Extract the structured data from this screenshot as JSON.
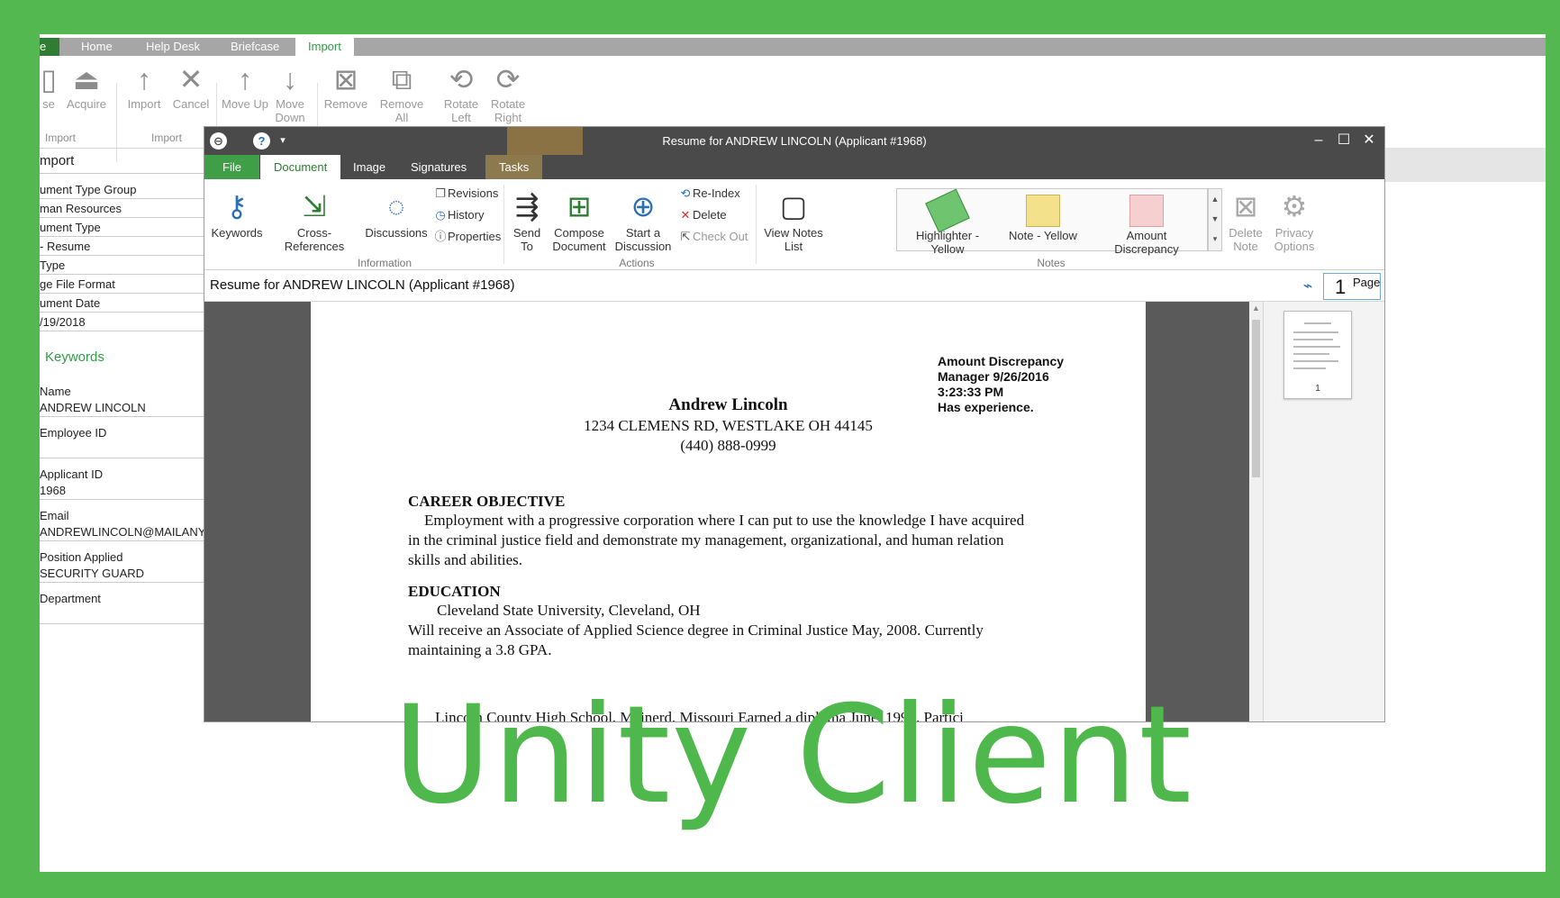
{
  "colors": {
    "frame_green": "#52b84f",
    "brand_green": "#4fb84c",
    "accent": "#2a6fb5"
  },
  "background_app": {
    "tabs": [
      "Home",
      "Help Desk",
      "Briefcase",
      "Import"
    ],
    "active_tab": "Import",
    "ribbon_buttons": [
      {
        "label": "se",
        "icon": "doc-icon"
      },
      {
        "label": "Acquire",
        "icon": "scanner-icon"
      },
      {
        "label": "Import",
        "icon": "arrow-up-icon"
      },
      {
        "label": "Cancel",
        "icon": "x-icon"
      },
      {
        "label": "Move Up",
        "icon": "arrow-up-icon"
      },
      {
        "label": "Move Down",
        "icon": "arrow-down-icon"
      },
      {
        "label": "Remove",
        "icon": "remove-page-icon"
      },
      {
        "label": "Remove All",
        "icon": "remove-all-icon"
      },
      {
        "label": "Rotate Left",
        "icon": "rotate-left-icon"
      },
      {
        "label": "Rotate Right",
        "icon": "rotate-right-icon"
      }
    ],
    "groups": [
      "Import",
      "Import"
    ],
    "panel": {
      "title": "mport",
      "fields": [
        "ument Type Group",
        "man Resources",
        "ument Type",
        "- Resume",
        "Type",
        "ge File Format",
        "ument Date",
        "/19/2018"
      ],
      "keywords_title": "Keywords",
      "keywords": [
        {
          "label": "Name",
          "value": "ANDREW LINCOLN"
        },
        {
          "label": "Employee ID",
          "value": ""
        },
        {
          "label": "Applicant ID",
          "value": "1968"
        },
        {
          "label": "Email",
          "value": "ANDREWLINCOLN@MAILANY"
        },
        {
          "label": "Position Applied",
          "value": "SECURITY GUARD"
        },
        {
          "label": "Department",
          "value": ""
        }
      ]
    }
  },
  "window": {
    "title": "Resume for ANDREW LINCOLN (Applicant #1968)",
    "tabs": [
      "File",
      "Document",
      "Image",
      "Signatures",
      "Tasks"
    ],
    "active_tab": "Document",
    "ribbon": {
      "keywords": "Keywords",
      "cross_references": "Cross-References",
      "discussions": "Discussions",
      "revisions": "Revisions",
      "history": "History",
      "properties": "Properties",
      "send_to": "Send To",
      "compose_document": "Compose Document",
      "start_discussion": "Start a Discussion",
      "re_index": "Re-Index",
      "delete": "Delete",
      "check_out": "Check Out",
      "view_notes_list": "View Notes List",
      "highlighter_yellow": "Highlighter - Yellow",
      "note_yellow": "Note - Yellow",
      "amount_discrepancy": "Amount Discrepancy",
      "delete_note": "Delete Note",
      "privacy_options": "Privacy Options",
      "group_information": "Information",
      "group_actions": "Actions",
      "group_notes": "Notes"
    },
    "doc_title": "Resume for ANDREW LINCOLN (Applicant #1968)",
    "page_number": "1",
    "page_label": "Page",
    "thumbnail_page": "1"
  },
  "document": {
    "note": [
      "Amount Discrepancy",
      "Manager 9/26/2016",
      "3:23:33 PM",
      "Has experience."
    ],
    "name": "Andrew Lincoln",
    "address": "1234 CLEMENS RD, WESTLAKE OH 44145",
    "phone": "(440) 888-0999",
    "career_heading": "CAREER OBJECTIVE",
    "career_text": "Employment with a progressive corporation where I can put to use the knowledge I have acquired in the criminal justice field and demonstrate my management, organizational, and human relation skills and abilities.",
    "education_heading": "EDUCATION",
    "education_school": "Cleveland State University, Cleveland, OH",
    "education_text": "Will receive an Associate of Applied Science degree in Criminal Justice May, 2008.  Currently maintaining a 3.8 GPA.",
    "cut_line": "Lincoln County High School, Meinerd, Missouri    Earned a diploma June, 1994.  Partici"
  },
  "brand_text": "Unity Client"
}
